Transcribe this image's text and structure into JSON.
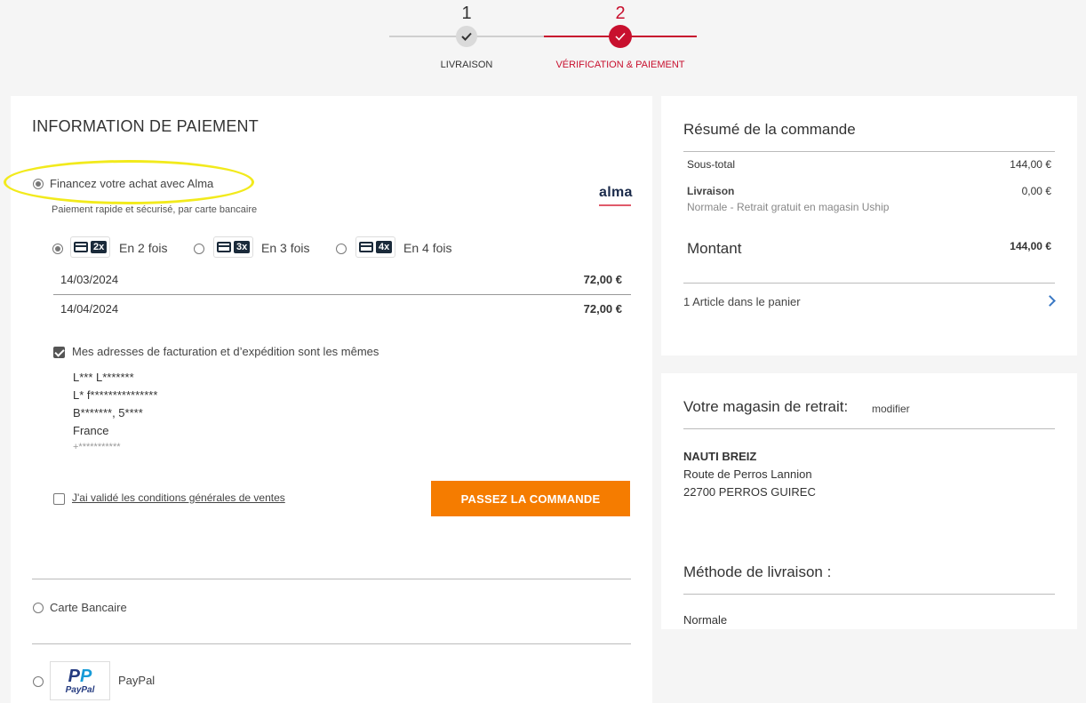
{
  "stepper": {
    "step1": {
      "number": "1",
      "label": "LIVRAISON"
    },
    "step2": {
      "number": "2",
      "label": "VÉRIFICATION & PAIEMENT"
    }
  },
  "payment": {
    "title": "INFORMATION DE PAIEMENT",
    "alma": {
      "label": "Financez votre achat avec Alma",
      "subtitle": "Paiement rapide et sécurisé, par carte bancaire",
      "logo": "alma",
      "options": [
        {
          "badge": "2x",
          "label": "En 2 fois",
          "selected": true
        },
        {
          "badge": "3x",
          "label": "En 3 fois",
          "selected": false
        },
        {
          "badge": "4x",
          "label": "En 4 fois",
          "selected": false
        }
      ],
      "schedule": [
        {
          "date": "14/03/2024",
          "amount": "72,00 €"
        },
        {
          "date": "14/04/2024",
          "amount": "72,00 €"
        }
      ]
    },
    "same_address_label": "Mes adresses de facturation et d’expédition sont les mêmes",
    "address": {
      "line1": "L*** L*******",
      "line2": "L* f***************",
      "line3": "B*******, 5****",
      "line4": "France",
      "line5": "+***********"
    },
    "terms_label": "J'ai validé les conditions générales de ventes",
    "submit_label": "PASSEZ LA COMMANDE",
    "card_label": "Carte Bancaire",
    "paypal_label": "PayPal",
    "paypal_logo_text": "PayPal"
  },
  "summary": {
    "title": "Résumé de la commande",
    "subtotal_label": "Sous-total",
    "subtotal_value": "144,00 €",
    "shipping_label": "Livraison",
    "shipping_value": "0,00 €",
    "shipping_detail": "Normale - Retrait gratuit en magasin Uship",
    "total_label": "Montant",
    "total_value": "144,00 €",
    "cart_label": "1 Article dans le panier"
  },
  "store": {
    "title": "Votre magasin de retrait:",
    "modify_label": "modifier",
    "name": "NAUTI BREIZ",
    "street": "Route de Perros Lannion",
    "city": "22700 PERROS GUIREC",
    "method_title": "Méthode de livraison :",
    "method_value": "Normale"
  },
  "colors": {
    "accent_red": "#c8102e",
    "cta_orange": "#f57c00",
    "highlight_yellow": "#f2ea1c",
    "link_blue": "#3a78c4"
  }
}
